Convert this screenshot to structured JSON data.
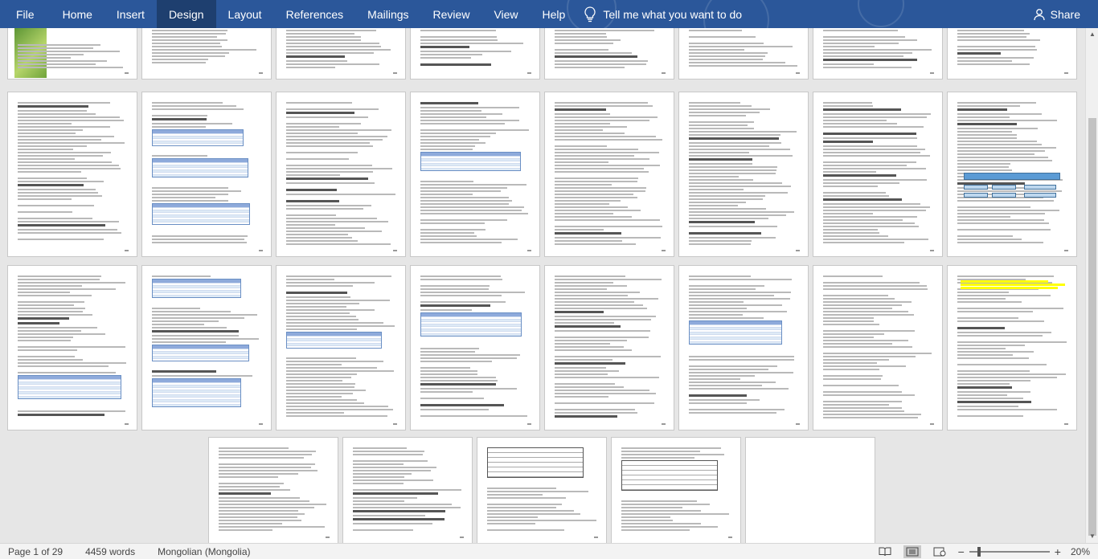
{
  "ribbon": {
    "tabs": [
      {
        "label": "File"
      },
      {
        "label": "Home"
      },
      {
        "label": "Insert"
      },
      {
        "label": "Design",
        "active": true
      },
      {
        "label": "Layout"
      },
      {
        "label": "References"
      },
      {
        "label": "Mailings"
      },
      {
        "label": "Review"
      },
      {
        "label": "View"
      },
      {
        "label": "Help"
      }
    ],
    "tell_me": "Tell me what you want to do",
    "share": "Share",
    "accent_color": "#2b579a"
  },
  "status": {
    "page": "Page 1 of 29",
    "words": "4459 words",
    "language": "Mongolian (Mongolia)",
    "zoom": "20%"
  },
  "icons": {
    "tell_me": "lightbulb-icon",
    "share": "person-icon",
    "read_mode": "read-mode-icon",
    "print_layout": "print-layout-icon",
    "web_layout": "web-layout-icon"
  }
}
